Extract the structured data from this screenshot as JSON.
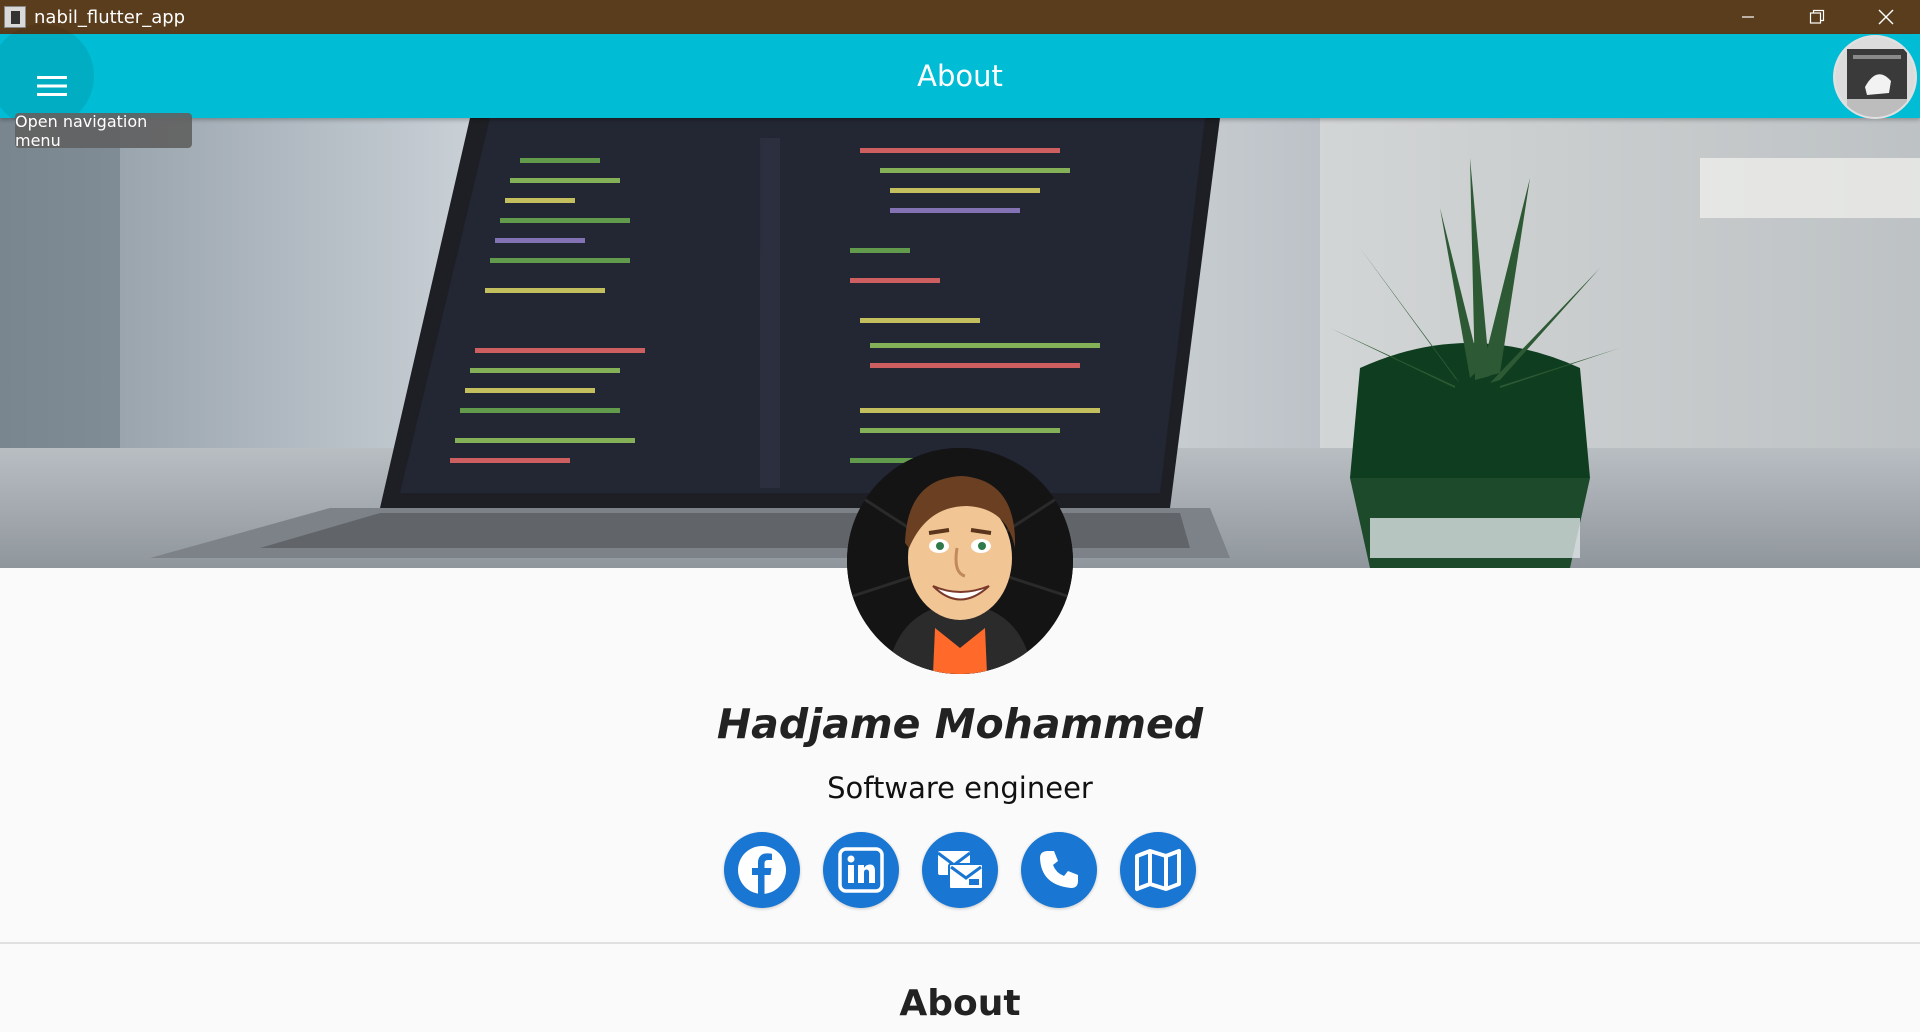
{
  "window": {
    "title": "nabil_flutter_app",
    "controls": [
      "minimize",
      "restore",
      "close"
    ]
  },
  "appbar": {
    "title": "About",
    "menu_icon": "hamburger-menu-icon",
    "tooltip": "Open navigation menu"
  },
  "profile": {
    "name": "Hadjame Mohammed",
    "role": "Software engineer"
  },
  "socials": [
    {
      "name": "facebook",
      "icon": "facebook-icon"
    },
    {
      "name": "linkedin",
      "icon": "linkedin-icon"
    },
    {
      "name": "email",
      "icon": "mail-icon"
    },
    {
      "name": "phone",
      "icon": "phone-icon"
    },
    {
      "name": "map",
      "icon": "map-icon"
    }
  ],
  "section": {
    "title": "About"
  },
  "colors": {
    "titlebar": "#5a3d1c",
    "appbar": "#00bcd4",
    "social_button": "#1976d2",
    "background": "#fafafa"
  }
}
